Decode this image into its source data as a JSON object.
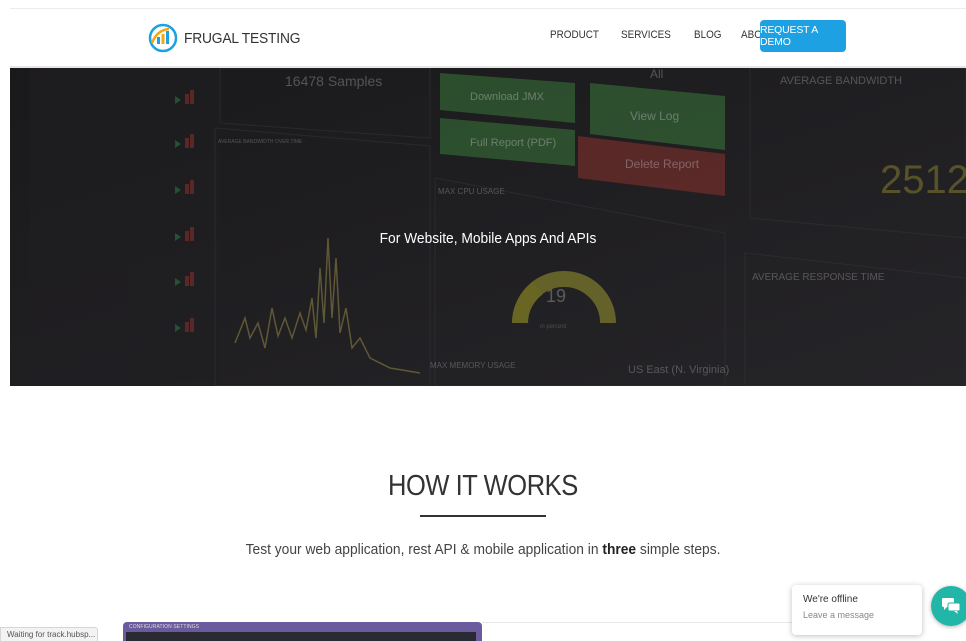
{
  "header": {
    "logo_text": "FRUGAL TESTING",
    "nav": [
      {
        "label": "PRODUCT"
      },
      {
        "label": "SERVICES"
      },
      {
        "label": "BLOG"
      },
      {
        "label": "ABOUT"
      }
    ],
    "cta_label": "REQUEST A DEMO",
    "accent": "#1da1e2"
  },
  "hero": {
    "title": "For Website, Mobile Apps And APIs",
    "bg_text": {
      "samples": "16478 Samples",
      "download_jmx": "Download JMX",
      "full_report": "Full Report (PDF)",
      "view_log": "View Log",
      "delete_report": "Delete Report",
      "select_value": "All",
      "avg_bandwidth": "AVERAGE BANDWIDTH",
      "bandwidth_value": "2512",
      "avg_bandwidth_time": "AVERAGE BANDWIDTH OVER TIME",
      "max_cpu": "MAX CPU USAGE",
      "gauge_value": "19",
      "gauge_unit": "in percent",
      "avg_response": "AVERAGE RESPONSE TIME",
      "max_memory": "MAX MEMORY USAGE",
      "region": "US East (N. Virginia)"
    }
  },
  "how": {
    "title": "HOW IT WORKS",
    "sub_before": "Test your web application, rest API & mobile application in ",
    "sub_bold": "three",
    "sub_after": " simple steps."
  },
  "preview": {
    "label": "CONFIGURATION SETTINGS"
  },
  "status_bar": {
    "text": "Waiting for track.hubsp..."
  },
  "chat": {
    "line1": "We're offline",
    "line2": "Leave a message",
    "color": "#21b6a8"
  }
}
